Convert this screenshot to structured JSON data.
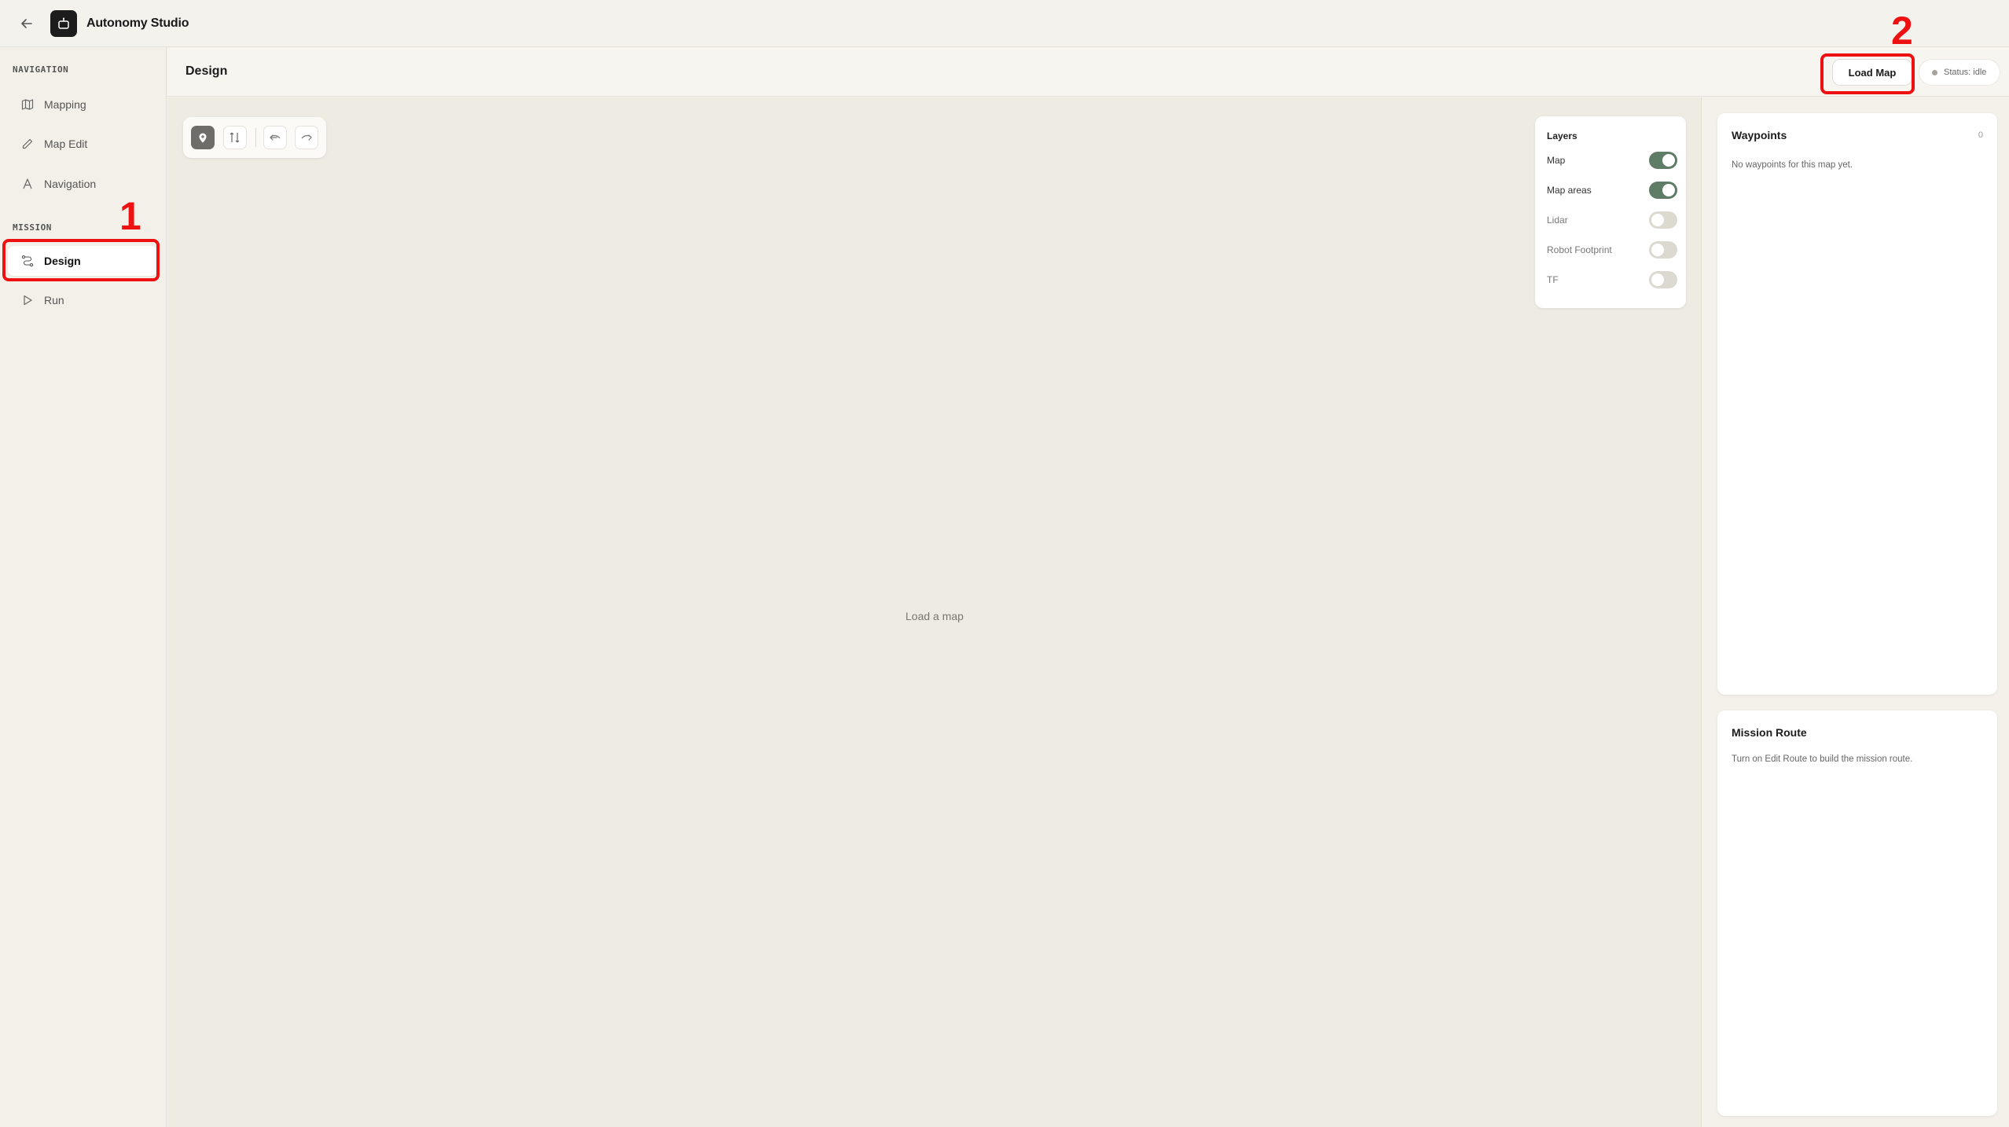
{
  "app": {
    "title": "Autonomy Studio"
  },
  "sidebar": {
    "sections": [
      {
        "label": "NAVIGATION"
      },
      {
        "label": "MISSION"
      }
    ],
    "items": [
      {
        "label": "Mapping",
        "icon": "map-icon"
      },
      {
        "label": "Map Edit",
        "icon": "pencil-icon"
      },
      {
        "label": "Navigation",
        "icon": "navigation-icon"
      },
      {
        "label": "Design",
        "icon": "route-icon",
        "active": true
      },
      {
        "label": "Run",
        "icon": "play-icon"
      }
    ]
  },
  "header": {
    "title": "Design",
    "load_map_label": "Load Map",
    "status_label": "Status: idle"
  },
  "canvas": {
    "empty_message": "Load a map",
    "toolbar": [
      {
        "icon": "add-waypoint-icon",
        "active": true
      },
      {
        "icon": "edit-route-icon",
        "active": false
      },
      {
        "icon": "undo-icon",
        "active": false
      },
      {
        "icon": "redo-icon",
        "active": false
      }
    ]
  },
  "layers": {
    "title": "Layers",
    "items": [
      {
        "label": "Map",
        "on": true
      },
      {
        "label": "Map areas",
        "on": true
      },
      {
        "label": "Lidar",
        "on": false
      },
      {
        "label": "Robot Footprint",
        "on": false
      },
      {
        "label": "TF",
        "on": false
      }
    ]
  },
  "waypoints": {
    "title": "Waypoints",
    "count": "0",
    "empty_text": "No waypoints for this map yet."
  },
  "mission_route": {
    "title": "Mission Route",
    "empty_text": "Turn on Edit Route to build the mission route."
  },
  "annotations": {
    "step1": "1",
    "step2": "2"
  },
  "colors": {
    "accent_green": "#5e7c66",
    "annotation_red": "#ee1111",
    "background": "#eeebe3"
  }
}
